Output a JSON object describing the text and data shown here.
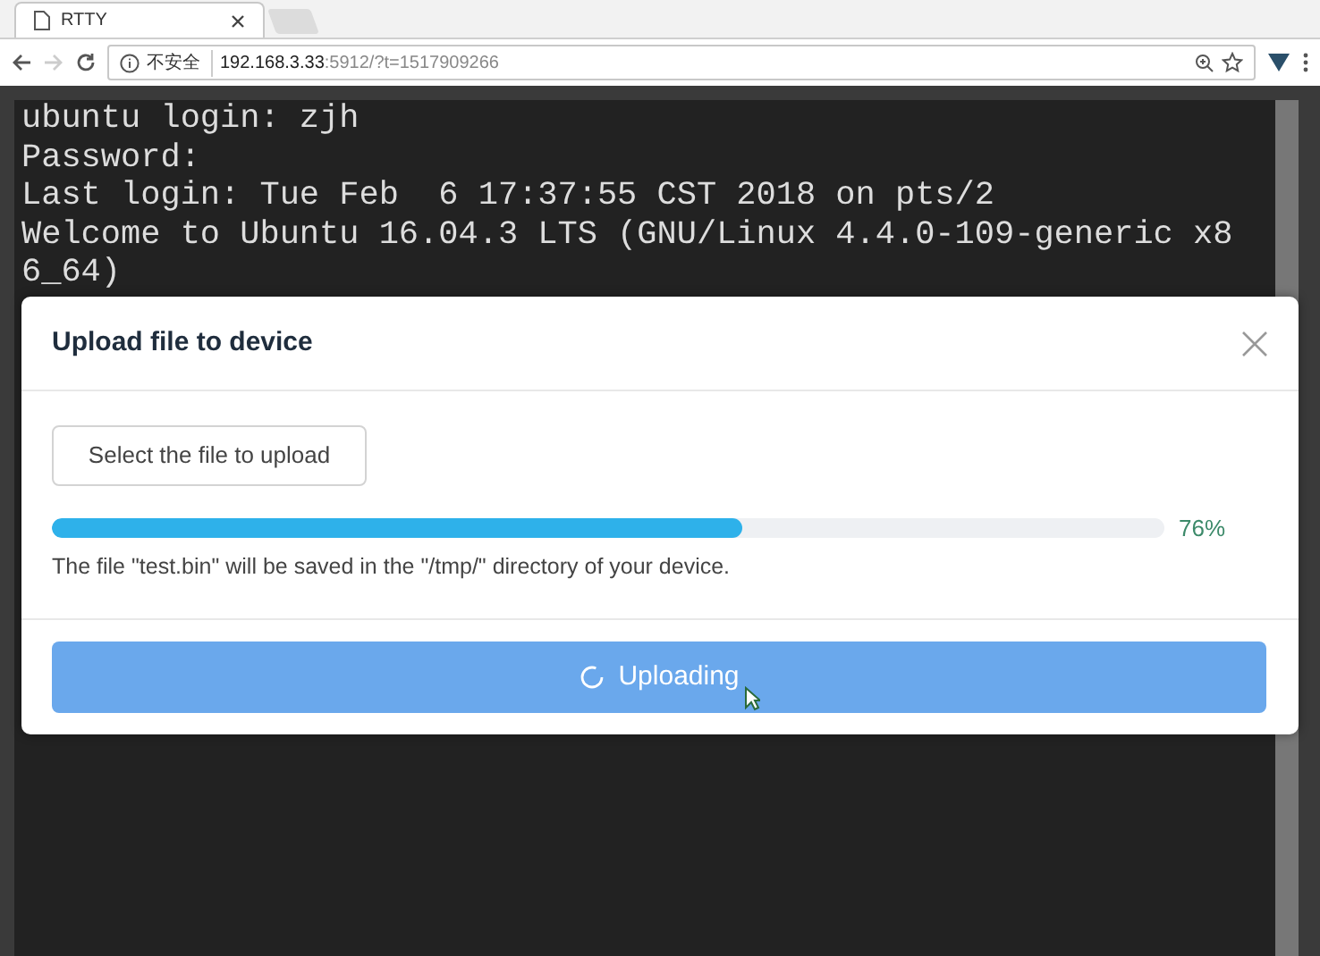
{
  "browser": {
    "tab": {
      "title": "RTTY",
      "selected": true
    },
    "address": {
      "security": "不安全",
      "host": "192.168.3.33",
      "path": ":5912/?t=1517909266"
    }
  },
  "terminal": {
    "lines": [
      "ubuntu login: zjh",
      "Password:",
      "Last login: Tue Feb  6 17:37:55 CST 2018 on pts/2",
      "Welcome to Ubuntu 16.04.3 LTS (GNU/Linux 4.4.0-109-generic x8",
      "6_64)"
    ]
  },
  "dialog": {
    "title": "Upload file to device",
    "select_button": "Select the file to upload",
    "progress": {
      "level": 0.62,
      "reading": "76%"
    },
    "note": "The file \"test.bin\" will be saved in the \"/tmp/\" directory of your device.",
    "upload_button": {
      "label": "Uploading",
      "loading": true
    }
  }
}
